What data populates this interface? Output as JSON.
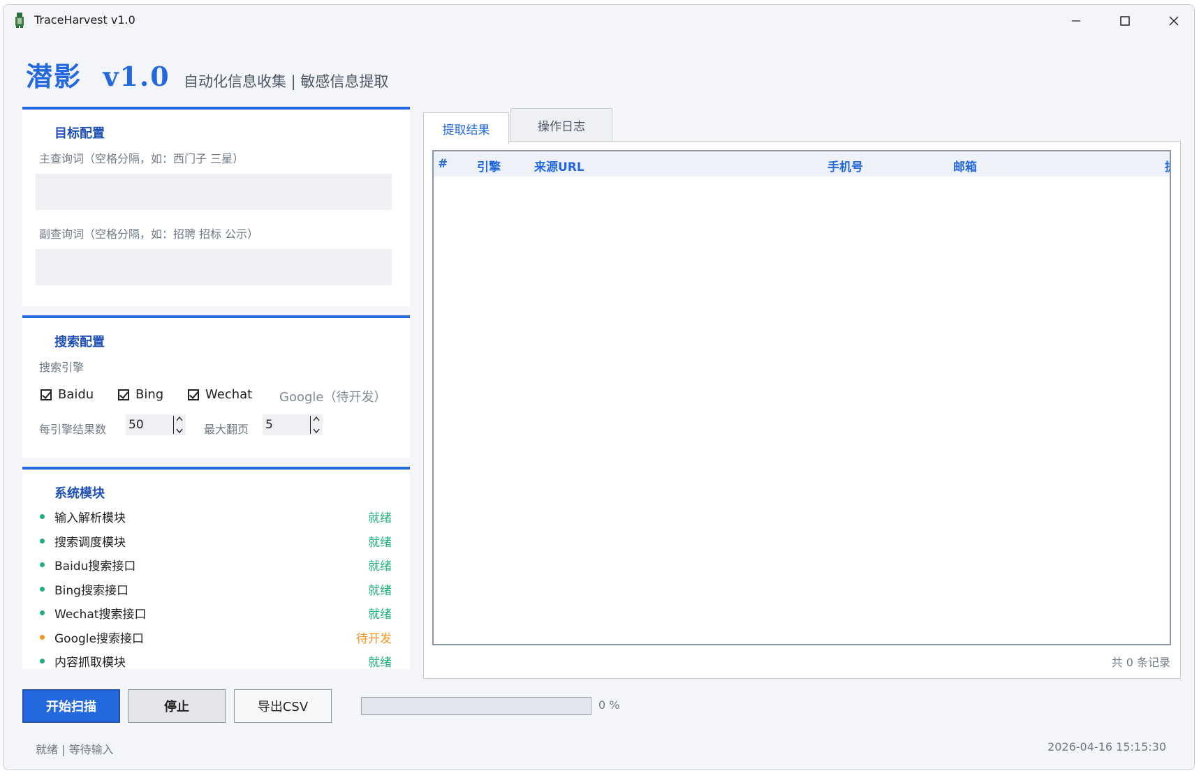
{
  "window": {
    "title": "TraceHarvest v1.0"
  },
  "header": {
    "brand": "潜影  v1.0",
    "subtitle": "自动化信息收集 | 敏感信息提取"
  },
  "target_config": {
    "title": "目标配置",
    "main_query_label": "主查询词（空格分隔，如：西门子 三星）",
    "main_query_value": "",
    "sub_query_label": "副查询词（空格分隔，如：招聘 招标 公示）",
    "sub_query_value": ""
  },
  "search_config": {
    "title": "搜索配置",
    "engines_label": "搜索引擎",
    "engines": [
      {
        "label": "Baidu",
        "checked": true
      },
      {
        "label": "Bing",
        "checked": true
      },
      {
        "label": "Wechat",
        "checked": true
      }
    ],
    "google_label": "Google（待开发）",
    "results_per_engine_label": "每引擎结果数",
    "results_per_engine_value": "50",
    "max_pages_label": "最大翻页",
    "max_pages_value": "5"
  },
  "system_modules": {
    "title": "系统模块",
    "items": [
      {
        "name": "输入解析模块",
        "status": "就绪"
      },
      {
        "name": "搜索调度模块",
        "status": "就绪"
      },
      {
        "name": "Baidu搜索接口",
        "status": "就绪"
      },
      {
        "name": "Bing搜索接口",
        "status": "就绪"
      },
      {
        "name": "Wechat搜索接口",
        "status": "就绪"
      },
      {
        "name": "Google搜索接口",
        "status": "待开发"
      },
      {
        "name": "内容抓取模块",
        "status": "就绪"
      }
    ]
  },
  "colors": {
    "accent": "#2468e0",
    "ready": "#1fb07a",
    "pending": "#f0961e"
  },
  "tabs": [
    {
      "label": "提取结果",
      "active": true
    },
    {
      "label": "操作日志",
      "active": false
    }
  ],
  "results_table": {
    "columns": [
      "#",
      "引擎",
      "来源URL",
      "手机号",
      "邮箱",
      "提"
    ],
    "rows": [],
    "record_count": "共 0 条记录"
  },
  "actions": {
    "start": "开始扫描",
    "stop": "停止",
    "export": "导出CSV"
  },
  "progress": {
    "percent": 0,
    "text": "0 %"
  },
  "status_bar": {
    "message": "就绪 | 等待输入",
    "timestamp": "2026-04-16 15:15:30"
  }
}
